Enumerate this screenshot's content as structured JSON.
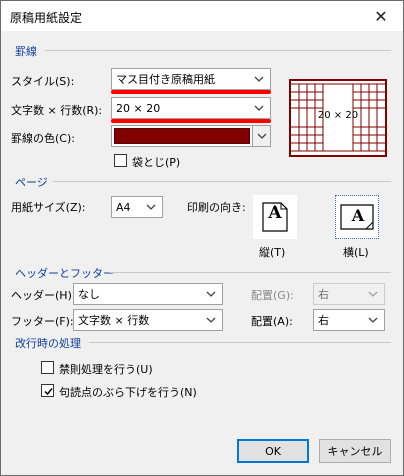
{
  "window": {
    "title": "原稿用紙設定",
    "close_glyph": "✕"
  },
  "ruled": {
    "section_title": "罫線",
    "style_label": "スタイル(S):",
    "style_value": "マス目付き原稿用紙",
    "chars_label": "文字数 × 行数(R):",
    "chars_value": "20 × 20",
    "color_label": "罫線の色(C):",
    "color_value": "#800000",
    "fold_label": "袋とじ(P)",
    "fold_checked": false,
    "preview_text": "20 × 20"
  },
  "page": {
    "section_title": "ページ",
    "paper_label": "用紙サイズ(Z):",
    "paper_value": "A4",
    "orient_label": "印刷の向き:",
    "portrait_label": "縦(T)",
    "landscape_label": "横(L)",
    "selected_orientation": "landscape",
    "orient_glyph": "A"
  },
  "header_footer": {
    "section_title": "ヘッダーとフッター",
    "header_label": "ヘッダー(H):",
    "header_value": "なし",
    "header_pos_label": "配置(G):",
    "header_pos_value": "右",
    "footer_label": "フッター(F):",
    "footer_value": "文字数 × 行数",
    "footer_pos_label": "配置(A):",
    "footer_pos_value": "右"
  },
  "linebreak": {
    "section_title": "改行時の処理",
    "kinsoku_label": "禁則処理を行う(U)",
    "kinsoku_checked": false,
    "hang_label": "句読点のぶら下げを行う(N)",
    "hang_checked": true
  },
  "buttons": {
    "ok": "OK",
    "cancel": "キャンセル"
  },
  "colors": {
    "accent": "#0f3e9c",
    "annotation": "#ff0000",
    "grid": "#800000",
    "focus": "#0078d7"
  }
}
